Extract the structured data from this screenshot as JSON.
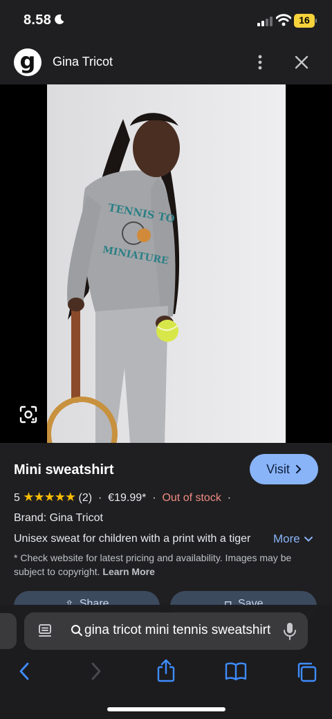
{
  "status_bar": {
    "time": "8.58",
    "battery_level": "16"
  },
  "header": {
    "site_name": "Gina Tricot",
    "logo_letter": "g"
  },
  "product_image": {
    "print_text_top": "TENNIS TO",
    "print_text_bottom": "MINIATURE"
  },
  "product": {
    "title": "Mini sweatshirt",
    "visit_label": "Visit",
    "rating_value": "5",
    "stars": "★★★★★",
    "review_count": "(2)",
    "separator": "·",
    "price": "€19.99*",
    "stock_status": "Out of stock",
    "brand_line": "Brand: Gina Tricot",
    "description": "Unisex sweat for children with a print with a tiger",
    "more_label": "More",
    "disclaimer": "* Check website for latest pricing and availability. Images may be subject to copyright.",
    "learn_more": "Learn More",
    "share_label": "Share",
    "save_label": "Save"
  },
  "browser": {
    "url_text": "gina tricot mini tennis sweatshirt"
  },
  "colors": {
    "accent": "#8ab4f8",
    "stars": "#fbbc04",
    "out_of_stock": "#f28b82",
    "background": "#1f1f21"
  }
}
